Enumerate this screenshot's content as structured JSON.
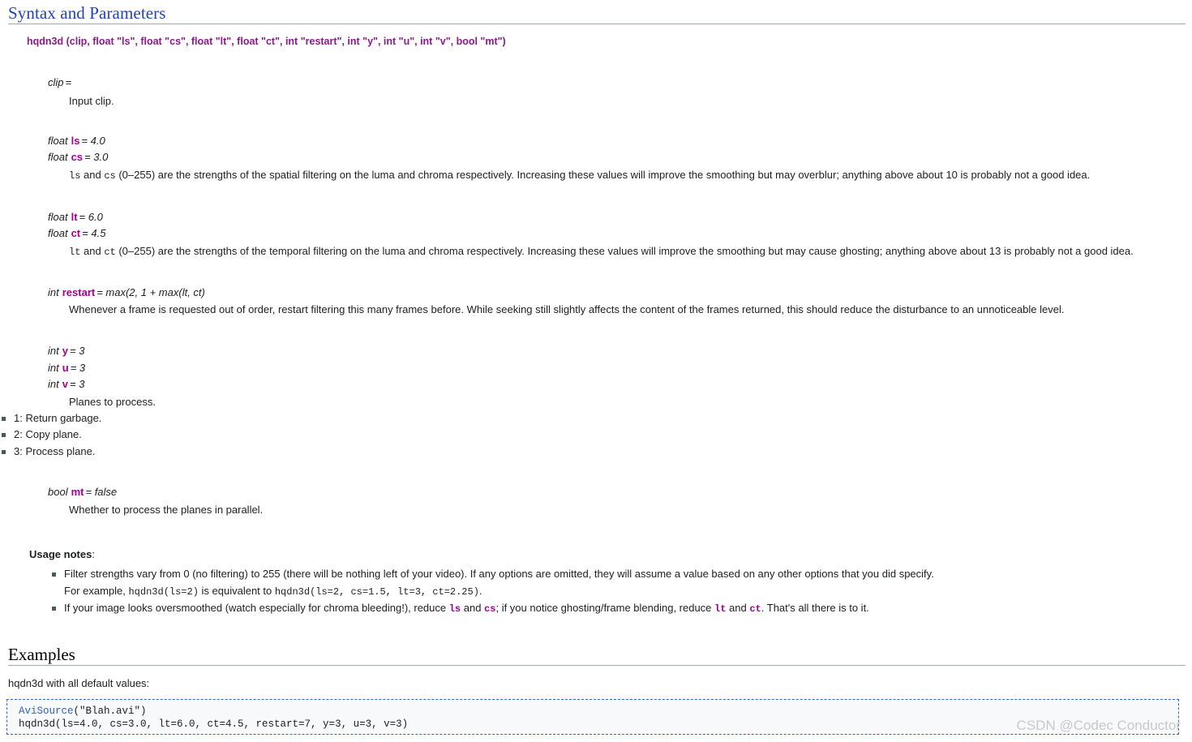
{
  "sections": {
    "syntax": {
      "heading": "Syntax and Parameters",
      "signature": "hqdn3d (clip, float \"ls\", float \"cs\", float \"lt\", float \"ct\", int \"restart\", int \"y\", int \"u\", int \"v\", bool \"mt\")"
    },
    "examples": {
      "heading": "Examples",
      "caption": "hqdn3d with all default values:",
      "code": {
        "fn": "AviSource",
        "args": "(\"Blah.avi\")",
        "line2": "hqdn3d(ls=4.0, cs=3.0, lt=6.0, ct=4.5, restart=7, y=3, u=3, v=3)"
      }
    }
  },
  "params": [
    {
      "type": "clip",
      "name": "",
      "eq": "=",
      "default": "",
      "desc": "Input clip."
    },
    {
      "type": "float",
      "name": "ls",
      "eq": "=",
      "default": "4.0"
    },
    {
      "type": "float",
      "name": "cs",
      "eq": "=",
      "default": "3.0",
      "desc_code_a": "ls",
      "desc_mid": " and ",
      "desc_code_b": "cs",
      "desc_tail": " (0–255) are the strengths of the spatial filtering on the luma and chroma respectively. Increasing these values will improve the smoothing but may overblur; anything above about 10 is probably not a good idea."
    },
    {
      "type": "float",
      "name": "lt",
      "eq": "=",
      "default": "6.0"
    },
    {
      "type": "float",
      "name": "ct",
      "eq": "=",
      "default": "4.5",
      "desc_code_a": "lt",
      "desc_mid": " and ",
      "desc_code_b": "ct",
      "desc_tail": " (0–255) are the strengths of the temporal filtering on the luma and chroma respectively. Increasing these values will improve the smoothing but may cause ghosting; anything above about 13 is probably not a good idea."
    },
    {
      "type": "int",
      "name": "restart",
      "eq": "=",
      "default": "max(2, 1 + max(lt, ct)",
      "desc": "Whenever a frame is requested out of order, restart filtering this many frames before. While seeking still slightly affects the content of the frames returned, this should reduce the disturbance to an unnoticeable level."
    },
    {
      "type": "int",
      "name": "y",
      "eq": "=",
      "default": "3"
    },
    {
      "type": "int",
      "name": "u",
      "eq": "=",
      "default": "3"
    },
    {
      "type": "int",
      "name": "v",
      "eq": "=",
      "default": "3",
      "desc": "Planes to process.",
      "planes": [
        "1: Return garbage.",
        "2: Copy plane.",
        "3: Process plane."
      ]
    },
    {
      "type": "bool",
      "name": "mt",
      "eq": "=",
      "default": "false",
      "desc": "Whether to process the planes in parallel."
    }
  ],
  "usage_notes": {
    "title": "Usage notes",
    "title_colon": ":",
    "note1": {
      "text": "Filter strengths vary from 0 (no filtering) to 255 (there will be nothing left of your video). If any options are omitted, they will assume a value based on any other options that you did specify.",
      "sub_prefix": "For example, ",
      "sub_code_a": "hqdn3d(ls=2)",
      "sub_mid": " is equivalent to ",
      "sub_code_b": "hqdn3d(ls=2, cs=1.5, lt=3, ct=2.25)",
      "sub_tail": "."
    },
    "note2": {
      "prefix": "If your image looks oversmoothed (watch especially for chroma bleeding!), reduce ",
      "code_a": "ls",
      "mid1": " and ",
      "code_b": "cs",
      "mid2": "; if you notice ghosting/frame blending, reduce ",
      "code_c": "lt",
      "mid3": " and ",
      "code_d": "ct",
      "tail": ". That's all there is to it."
    }
  },
  "watermark": "CSDN @Codec Conductor",
  "colors": {
    "heading_link": "#2244bb",
    "signature": "#8b1a8b",
    "param_name": "#a2008f",
    "code_fn": "#2b63c4",
    "code_border": "#3366cc",
    "code_bg": "#f8f9fa",
    "rule": "#a2a9b1",
    "watermark": "#c9c9c9"
  }
}
